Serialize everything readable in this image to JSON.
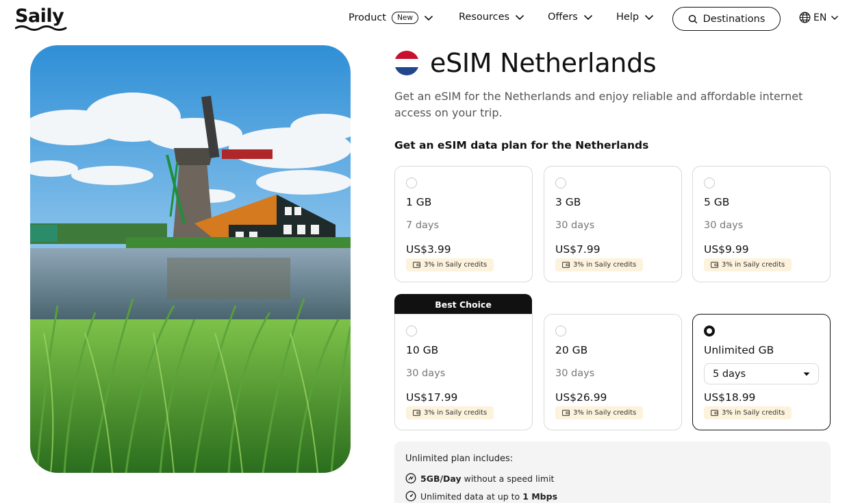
{
  "header": {
    "logo": "Saily",
    "nav": [
      {
        "label": "Product",
        "badge": "New"
      },
      {
        "label": "Resources"
      },
      {
        "label": "Offers"
      },
      {
        "label": "Help"
      }
    ],
    "destinations_label": "Destinations",
    "language": "EN"
  },
  "hero": {
    "icon": "windmill-landscape-photo"
  },
  "main": {
    "title": "eSIM Netherlands",
    "flag_colors": [
      "#c8102e",
      "#ffffff",
      "#21468b"
    ],
    "subtitle": "Get an eSIM for the Netherlands and enjoy reliable and affordable internet access on your trip.",
    "plans_heading": "Get an eSIM data plan for the Netherlands",
    "best_choice_label": "Best Choice",
    "plans": [
      {
        "data": "1 GB",
        "days": "7 days",
        "price": "US$3.99",
        "credits": "3% in Saily credits"
      },
      {
        "data": "3 GB",
        "days": "30 days",
        "price": "US$7.99",
        "credits": "3% in Saily credits"
      },
      {
        "data": "5 GB",
        "days": "30 days",
        "price": "US$9.99",
        "credits": "3% in Saily credits"
      },
      {
        "data": "10 GB",
        "days": "30 days",
        "price": "US$17.99",
        "credits": "3% in Saily credits"
      },
      {
        "data": "20 GB",
        "days": "30 days",
        "price": "US$26.99",
        "credits": "3% in Saily credits"
      },
      {
        "data": "Unlimited GB",
        "days": "5 days",
        "price": "US$18.99",
        "credits": "3% in Saily credits",
        "selected": true
      }
    ],
    "includes": {
      "title": "Unlimited plan includes:",
      "items": [
        {
          "bold": "5GB/Day",
          "text": " without a speed limit"
        },
        {
          "text": "Unlimited data at up to ",
          "bold": "1 Mbps"
        }
      ]
    }
  },
  "colors": {
    "credits_bg": "#fdf2dc",
    "best_bg": "#111111"
  }
}
